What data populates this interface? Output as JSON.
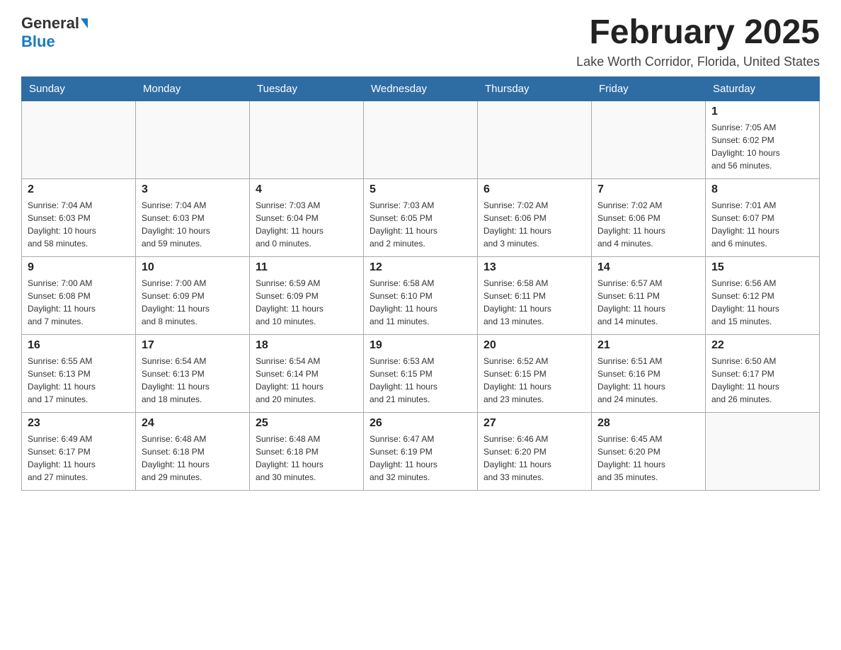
{
  "header": {
    "logo_general": "General",
    "logo_blue": "Blue",
    "title": "February 2025",
    "subtitle": "Lake Worth Corridor, Florida, United States"
  },
  "days_of_week": [
    "Sunday",
    "Monday",
    "Tuesday",
    "Wednesday",
    "Thursday",
    "Friday",
    "Saturday"
  ],
  "weeks": [
    [
      {
        "day": "",
        "info": ""
      },
      {
        "day": "",
        "info": ""
      },
      {
        "day": "",
        "info": ""
      },
      {
        "day": "",
        "info": ""
      },
      {
        "day": "",
        "info": ""
      },
      {
        "day": "",
        "info": ""
      },
      {
        "day": "1",
        "info": "Sunrise: 7:05 AM\nSunset: 6:02 PM\nDaylight: 10 hours\nand 56 minutes."
      }
    ],
    [
      {
        "day": "2",
        "info": "Sunrise: 7:04 AM\nSunset: 6:03 PM\nDaylight: 10 hours\nand 58 minutes."
      },
      {
        "day": "3",
        "info": "Sunrise: 7:04 AM\nSunset: 6:03 PM\nDaylight: 10 hours\nand 59 minutes."
      },
      {
        "day": "4",
        "info": "Sunrise: 7:03 AM\nSunset: 6:04 PM\nDaylight: 11 hours\nand 0 minutes."
      },
      {
        "day": "5",
        "info": "Sunrise: 7:03 AM\nSunset: 6:05 PM\nDaylight: 11 hours\nand 2 minutes."
      },
      {
        "day": "6",
        "info": "Sunrise: 7:02 AM\nSunset: 6:06 PM\nDaylight: 11 hours\nand 3 minutes."
      },
      {
        "day": "7",
        "info": "Sunrise: 7:02 AM\nSunset: 6:06 PM\nDaylight: 11 hours\nand 4 minutes."
      },
      {
        "day": "8",
        "info": "Sunrise: 7:01 AM\nSunset: 6:07 PM\nDaylight: 11 hours\nand 6 minutes."
      }
    ],
    [
      {
        "day": "9",
        "info": "Sunrise: 7:00 AM\nSunset: 6:08 PM\nDaylight: 11 hours\nand 7 minutes."
      },
      {
        "day": "10",
        "info": "Sunrise: 7:00 AM\nSunset: 6:09 PM\nDaylight: 11 hours\nand 8 minutes."
      },
      {
        "day": "11",
        "info": "Sunrise: 6:59 AM\nSunset: 6:09 PM\nDaylight: 11 hours\nand 10 minutes."
      },
      {
        "day": "12",
        "info": "Sunrise: 6:58 AM\nSunset: 6:10 PM\nDaylight: 11 hours\nand 11 minutes."
      },
      {
        "day": "13",
        "info": "Sunrise: 6:58 AM\nSunset: 6:11 PM\nDaylight: 11 hours\nand 13 minutes."
      },
      {
        "day": "14",
        "info": "Sunrise: 6:57 AM\nSunset: 6:11 PM\nDaylight: 11 hours\nand 14 minutes."
      },
      {
        "day": "15",
        "info": "Sunrise: 6:56 AM\nSunset: 6:12 PM\nDaylight: 11 hours\nand 15 minutes."
      }
    ],
    [
      {
        "day": "16",
        "info": "Sunrise: 6:55 AM\nSunset: 6:13 PM\nDaylight: 11 hours\nand 17 minutes."
      },
      {
        "day": "17",
        "info": "Sunrise: 6:54 AM\nSunset: 6:13 PM\nDaylight: 11 hours\nand 18 minutes."
      },
      {
        "day": "18",
        "info": "Sunrise: 6:54 AM\nSunset: 6:14 PM\nDaylight: 11 hours\nand 20 minutes."
      },
      {
        "day": "19",
        "info": "Sunrise: 6:53 AM\nSunset: 6:15 PM\nDaylight: 11 hours\nand 21 minutes."
      },
      {
        "day": "20",
        "info": "Sunrise: 6:52 AM\nSunset: 6:15 PM\nDaylight: 11 hours\nand 23 minutes."
      },
      {
        "day": "21",
        "info": "Sunrise: 6:51 AM\nSunset: 6:16 PM\nDaylight: 11 hours\nand 24 minutes."
      },
      {
        "day": "22",
        "info": "Sunrise: 6:50 AM\nSunset: 6:17 PM\nDaylight: 11 hours\nand 26 minutes."
      }
    ],
    [
      {
        "day": "23",
        "info": "Sunrise: 6:49 AM\nSunset: 6:17 PM\nDaylight: 11 hours\nand 27 minutes."
      },
      {
        "day": "24",
        "info": "Sunrise: 6:48 AM\nSunset: 6:18 PM\nDaylight: 11 hours\nand 29 minutes."
      },
      {
        "day": "25",
        "info": "Sunrise: 6:48 AM\nSunset: 6:18 PM\nDaylight: 11 hours\nand 30 minutes."
      },
      {
        "day": "26",
        "info": "Sunrise: 6:47 AM\nSunset: 6:19 PM\nDaylight: 11 hours\nand 32 minutes."
      },
      {
        "day": "27",
        "info": "Sunrise: 6:46 AM\nSunset: 6:20 PM\nDaylight: 11 hours\nand 33 minutes."
      },
      {
        "day": "28",
        "info": "Sunrise: 6:45 AM\nSunset: 6:20 PM\nDaylight: 11 hours\nand 35 minutes."
      },
      {
        "day": "",
        "info": ""
      }
    ]
  ]
}
